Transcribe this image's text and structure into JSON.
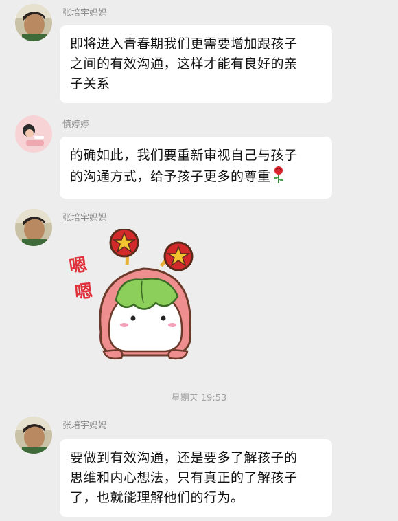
{
  "messages": [
    {
      "sender": "张培宇妈妈",
      "lines": [
        "即将进入青春期我们更需要增加跟孩子",
        "之间的有效沟通，这样才能有良好的亲",
        "子关系"
      ]
    },
    {
      "sender": "慎婷婷",
      "lines": [
        "的确如此，我们要重新审视自己与孩子",
        "的沟通方式，给予孩子更多的尊重"
      ],
      "emoji": "rose-icon"
    },
    {
      "sender": "张培宇妈妈",
      "sticker": {
        "text": [
          "嗯",
          "嗯"
        ]
      }
    },
    {
      "sender": "张培宇妈妈",
      "lines": [
        "要做到有效沟通，还是要多了解孩子的",
        "思维和内心想法，只有真正的了解孩子",
        "了，也就能理解他们的行为。"
      ]
    }
  ],
  "timestamp": "星期天 19:53",
  "colors": {
    "background": "#ededed",
    "bubble": "#ffffff",
    "sender_name": "#8c8c8c",
    "timestamp": "#a0a0a0",
    "sticker_text": "#e0303a"
  }
}
